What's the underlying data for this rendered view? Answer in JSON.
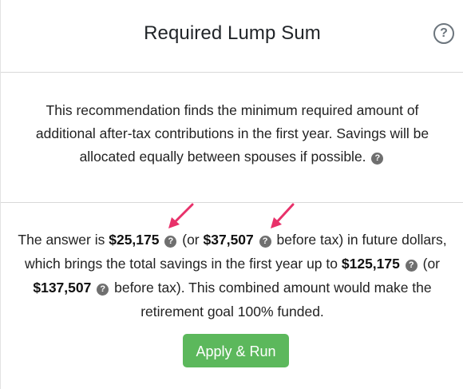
{
  "header": {
    "title": "Required Lump Sum",
    "help_icon": "question-circle-icon"
  },
  "description": {
    "text": "This recommendation finds the minimum required amount of additional after-tax contributions in the first year. Savings will be allocated equally between spouses if possible."
  },
  "answer": {
    "prefix": "The answer is",
    "amount_after_tax": "$25,175",
    "mid_1": "(or",
    "amount_before_tax": "$37,507",
    "suffix_1": "before tax) in future dollars, which brings the total savings in the first year up to",
    "total_after_tax": "$125,175",
    "mid_2": "(or",
    "total_before_tax": "$137,507",
    "suffix_2": "before tax). This combined amount would make the retirement goal 100% funded."
  },
  "actions": {
    "apply_label": "Apply & Run"
  },
  "colors": {
    "accent_green": "#5cb85c",
    "annotation_arrow": "#e8316a"
  }
}
